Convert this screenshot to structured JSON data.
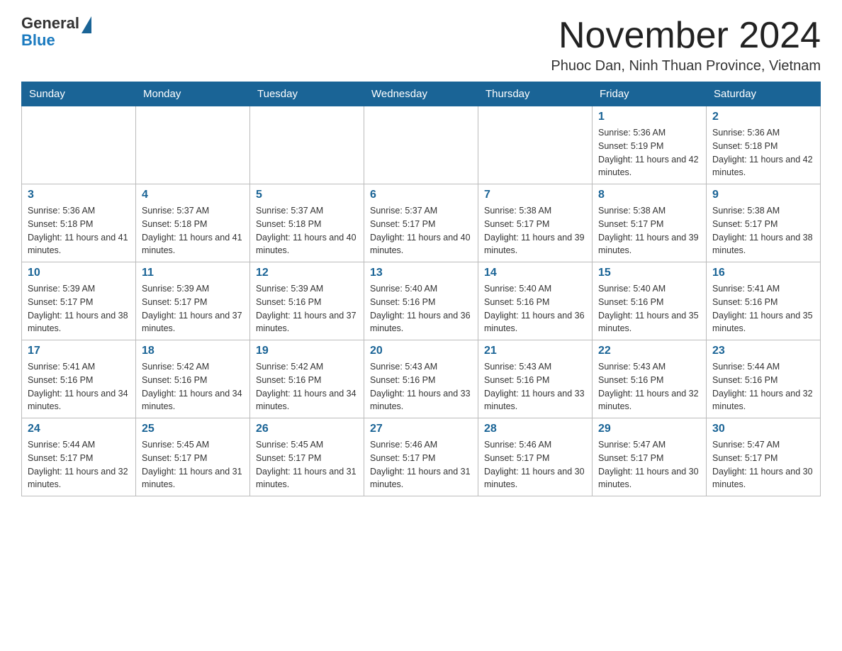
{
  "header": {
    "logo_general": "General",
    "logo_blue": "Blue",
    "title": "November 2024",
    "subtitle": "Phuoc Dan, Ninh Thuan Province, Vietnam"
  },
  "days_of_week": [
    "Sunday",
    "Monday",
    "Tuesday",
    "Wednesday",
    "Thursday",
    "Friday",
    "Saturday"
  ],
  "weeks": [
    {
      "days": [
        {
          "date": "",
          "info": ""
        },
        {
          "date": "",
          "info": ""
        },
        {
          "date": "",
          "info": ""
        },
        {
          "date": "",
          "info": ""
        },
        {
          "date": "",
          "info": ""
        },
        {
          "date": "1",
          "info": "Sunrise: 5:36 AM\nSunset: 5:19 PM\nDaylight: 11 hours and 42 minutes."
        },
        {
          "date": "2",
          "info": "Sunrise: 5:36 AM\nSunset: 5:18 PM\nDaylight: 11 hours and 42 minutes."
        }
      ]
    },
    {
      "days": [
        {
          "date": "3",
          "info": "Sunrise: 5:36 AM\nSunset: 5:18 PM\nDaylight: 11 hours and 41 minutes."
        },
        {
          "date": "4",
          "info": "Sunrise: 5:37 AM\nSunset: 5:18 PM\nDaylight: 11 hours and 41 minutes."
        },
        {
          "date": "5",
          "info": "Sunrise: 5:37 AM\nSunset: 5:18 PM\nDaylight: 11 hours and 40 minutes."
        },
        {
          "date": "6",
          "info": "Sunrise: 5:37 AM\nSunset: 5:17 PM\nDaylight: 11 hours and 40 minutes."
        },
        {
          "date": "7",
          "info": "Sunrise: 5:38 AM\nSunset: 5:17 PM\nDaylight: 11 hours and 39 minutes."
        },
        {
          "date": "8",
          "info": "Sunrise: 5:38 AM\nSunset: 5:17 PM\nDaylight: 11 hours and 39 minutes."
        },
        {
          "date": "9",
          "info": "Sunrise: 5:38 AM\nSunset: 5:17 PM\nDaylight: 11 hours and 38 minutes."
        }
      ]
    },
    {
      "days": [
        {
          "date": "10",
          "info": "Sunrise: 5:39 AM\nSunset: 5:17 PM\nDaylight: 11 hours and 38 minutes."
        },
        {
          "date": "11",
          "info": "Sunrise: 5:39 AM\nSunset: 5:17 PM\nDaylight: 11 hours and 37 minutes."
        },
        {
          "date": "12",
          "info": "Sunrise: 5:39 AM\nSunset: 5:16 PM\nDaylight: 11 hours and 37 minutes."
        },
        {
          "date": "13",
          "info": "Sunrise: 5:40 AM\nSunset: 5:16 PM\nDaylight: 11 hours and 36 minutes."
        },
        {
          "date": "14",
          "info": "Sunrise: 5:40 AM\nSunset: 5:16 PM\nDaylight: 11 hours and 36 minutes."
        },
        {
          "date": "15",
          "info": "Sunrise: 5:40 AM\nSunset: 5:16 PM\nDaylight: 11 hours and 35 minutes."
        },
        {
          "date": "16",
          "info": "Sunrise: 5:41 AM\nSunset: 5:16 PM\nDaylight: 11 hours and 35 minutes."
        }
      ]
    },
    {
      "days": [
        {
          "date": "17",
          "info": "Sunrise: 5:41 AM\nSunset: 5:16 PM\nDaylight: 11 hours and 34 minutes."
        },
        {
          "date": "18",
          "info": "Sunrise: 5:42 AM\nSunset: 5:16 PM\nDaylight: 11 hours and 34 minutes."
        },
        {
          "date": "19",
          "info": "Sunrise: 5:42 AM\nSunset: 5:16 PM\nDaylight: 11 hours and 34 minutes."
        },
        {
          "date": "20",
          "info": "Sunrise: 5:43 AM\nSunset: 5:16 PM\nDaylight: 11 hours and 33 minutes."
        },
        {
          "date": "21",
          "info": "Sunrise: 5:43 AM\nSunset: 5:16 PM\nDaylight: 11 hours and 33 minutes."
        },
        {
          "date": "22",
          "info": "Sunrise: 5:43 AM\nSunset: 5:16 PM\nDaylight: 11 hours and 32 minutes."
        },
        {
          "date": "23",
          "info": "Sunrise: 5:44 AM\nSunset: 5:16 PM\nDaylight: 11 hours and 32 minutes."
        }
      ]
    },
    {
      "days": [
        {
          "date": "24",
          "info": "Sunrise: 5:44 AM\nSunset: 5:17 PM\nDaylight: 11 hours and 32 minutes."
        },
        {
          "date": "25",
          "info": "Sunrise: 5:45 AM\nSunset: 5:17 PM\nDaylight: 11 hours and 31 minutes."
        },
        {
          "date": "26",
          "info": "Sunrise: 5:45 AM\nSunset: 5:17 PM\nDaylight: 11 hours and 31 minutes."
        },
        {
          "date": "27",
          "info": "Sunrise: 5:46 AM\nSunset: 5:17 PM\nDaylight: 11 hours and 31 minutes."
        },
        {
          "date": "28",
          "info": "Sunrise: 5:46 AM\nSunset: 5:17 PM\nDaylight: 11 hours and 30 minutes."
        },
        {
          "date": "29",
          "info": "Sunrise: 5:47 AM\nSunset: 5:17 PM\nDaylight: 11 hours and 30 minutes."
        },
        {
          "date": "30",
          "info": "Sunrise: 5:47 AM\nSunset: 5:17 PM\nDaylight: 11 hours and 30 minutes."
        }
      ]
    }
  ]
}
